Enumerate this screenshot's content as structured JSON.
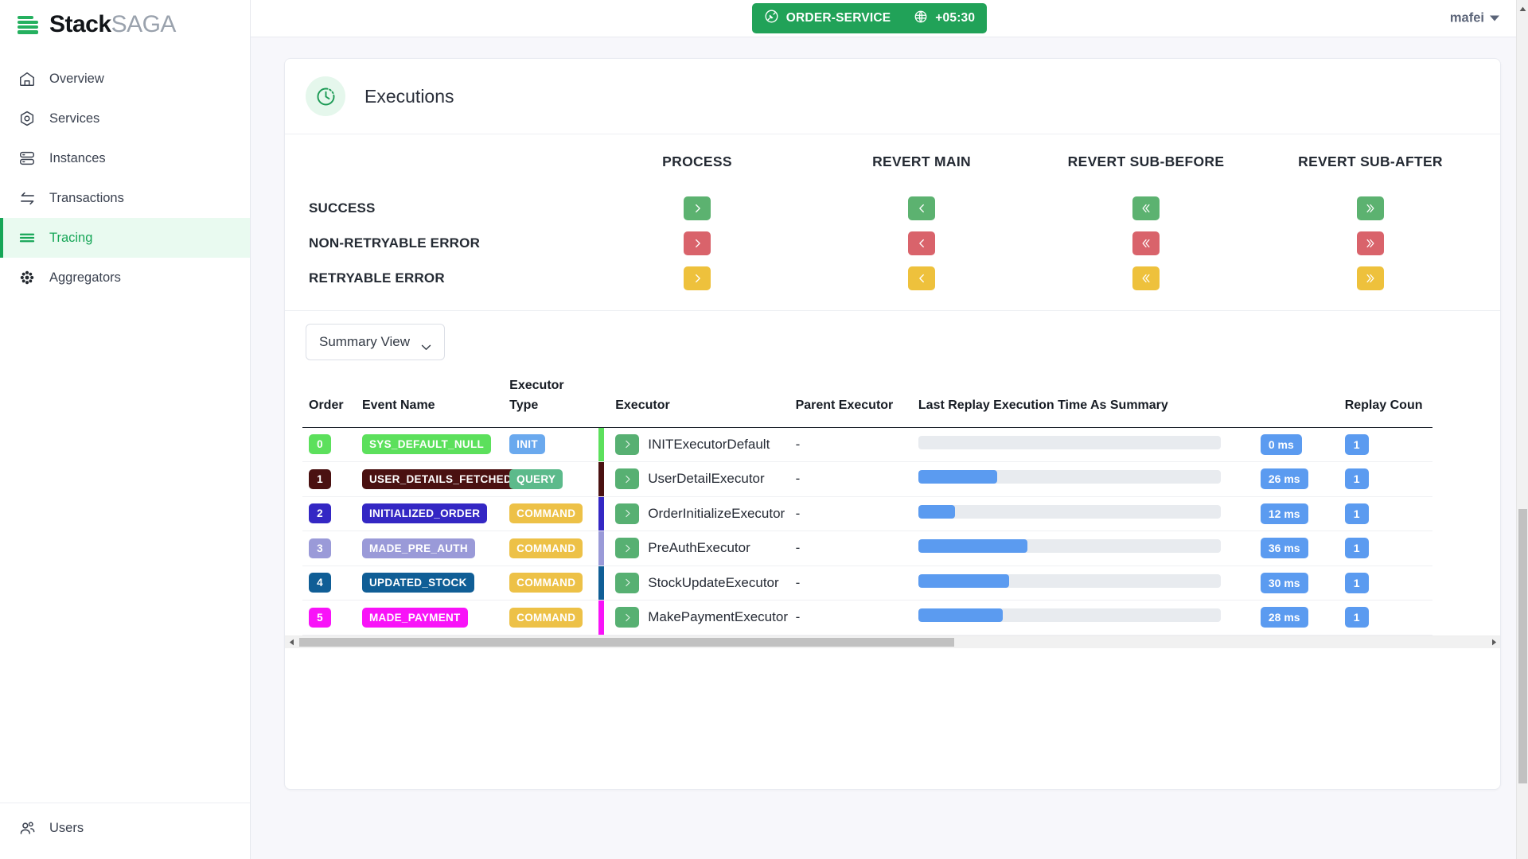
{
  "brand": {
    "name_bold": "Stack",
    "name_light": "SAGA",
    "logo_icon": "stacked-layers-icon"
  },
  "sidebar": {
    "items": [
      {
        "label": "Overview",
        "icon": "home-icon",
        "active": false
      },
      {
        "label": "Services",
        "icon": "hexagon-gear-icon",
        "active": false
      },
      {
        "label": "Instances",
        "icon": "server-stack-icon",
        "active": false
      },
      {
        "label": "Transactions",
        "icon": "exchange-arrows-icon",
        "active": false
      },
      {
        "label": "Tracing",
        "icon": "lines-icon",
        "active": true
      },
      {
        "label": "Aggregators",
        "icon": "asterisk-flower-icon",
        "active": false
      }
    ],
    "bottom_items": [
      {
        "label": "Users",
        "icon": "users-icon"
      }
    ],
    "active_color": "#16a657"
  },
  "topbar": {
    "service_badge": {
      "plug_icon": "plug-circle-icon",
      "label": "ORDER-SERVICE",
      "globe_icon": "globe-icon",
      "timezone": "+05:30",
      "color": "#21a258"
    },
    "user": {
      "name": "mafei",
      "caret_icon": "chevron-down-icon"
    }
  },
  "executions": {
    "icon": "clock-history-icon",
    "title": "Executions",
    "legend": {
      "columns": [
        "PROCESS",
        "REVERT MAIN",
        "REVERT SUB-BEFORE",
        "REVERT SUB-AFTER"
      ],
      "rows": [
        {
          "label": "SUCCESS",
          "color": "#5cb270",
          "class": "green"
        },
        {
          "label": "NON-RETRYABLE ERROR",
          "color": "#d9636b",
          "class": "red"
        },
        {
          "label": "RETRYABLE ERROR",
          "color": "#eec13c",
          "class": "amber"
        }
      ],
      "icons": [
        "chevron-right-icon",
        "chevron-left-icon",
        "chevron-double-left-icon",
        "chevron-double-right-icon"
      ]
    },
    "view_select": {
      "label": "Summary View",
      "caret_icon": "chevron-down-icon"
    },
    "table": {
      "headers": {
        "order": "Order",
        "event_name": "Event Name",
        "executor_type_line1": "Executor",
        "executor_type_line2": "Type",
        "executor": "Executor",
        "parent_executor": "Parent Executor",
        "last_replay": "Last Replay Execution Time As Summary",
        "replay_count": "Replay Coun"
      },
      "max_ms": 100,
      "rows": [
        {
          "order": "0",
          "order_color": "#5ce05c",
          "event_name": "SYS_DEFAULT_NULL",
          "event_color": "#5ce05c",
          "event_text_color": "#ffffff",
          "exec_type": "INIT",
          "exec_type_color": "#6aa9ee",
          "executor": "INITExecutorDefault",
          "parent_executor": "-",
          "ms": "0 ms",
          "ms_value": 0,
          "replay_count": "1",
          "row_color": "#5ce05c"
        },
        {
          "order": "1",
          "order_color": "#4a1111",
          "event_name": "USER_DETAILS_FETCHED",
          "event_color": "#4a1111",
          "event_text_color": "#ffffff",
          "exec_type": "QUERY",
          "exec_type_color": "#5cba8b",
          "executor": "UserDetailExecutor",
          "parent_executor": "-",
          "ms": "26 ms",
          "ms_value": 26,
          "replay_count": "1",
          "row_color": "#4a1111"
        },
        {
          "order": "2",
          "order_color": "#3427c4",
          "event_name": "INITIALIZED_ORDER",
          "event_color": "#3427c4",
          "event_text_color": "#ffffff",
          "exec_type": "COMMAND",
          "exec_type_color": "#edc147",
          "executor": "OrderInitializeExecutor",
          "parent_executor": "-",
          "ms": "12 ms",
          "ms_value": 12,
          "replay_count": "1",
          "row_color": "#3427c4"
        },
        {
          "order": "3",
          "order_color": "#9a9ad8",
          "event_name": "MADE_PRE_AUTH",
          "event_color": "#9a9ad8",
          "event_text_color": "#ffffff",
          "exec_type": "COMMAND",
          "exec_type_color": "#edc147",
          "executor": "PreAuthExecutor",
          "parent_executor": "-",
          "ms": "36 ms",
          "ms_value": 36,
          "replay_count": "1",
          "row_color": "#9a9ad8"
        },
        {
          "order": "4",
          "order_color": "#105e96",
          "event_name": "UPDATED_STOCK",
          "event_color": "#105e96",
          "event_text_color": "#ffffff",
          "exec_type": "COMMAND",
          "exec_type_color": "#edc147",
          "executor": "StockUpdateExecutor",
          "parent_executor": "-",
          "ms": "30 ms",
          "ms_value": 30,
          "replay_count": "1",
          "row_color": "#105e96"
        },
        {
          "order": "5",
          "order_color": "#f813f8",
          "event_name": "MADE_PAYMENT",
          "event_color": "#f813f8",
          "event_text_color": "#ffffff",
          "exec_type": "COMMAND",
          "exec_type_color": "#edc147",
          "executor": "MakePaymentExecutor",
          "parent_executor": "-",
          "ms": "28 ms",
          "ms_value": 28,
          "replay_count": "1",
          "row_color": "#f813f8"
        }
      ]
    }
  }
}
